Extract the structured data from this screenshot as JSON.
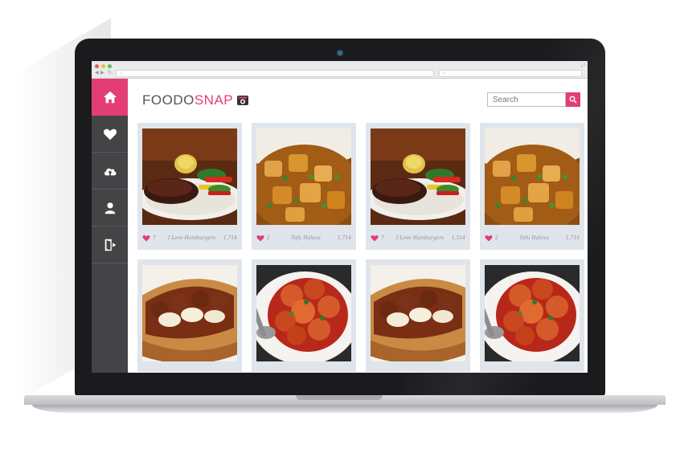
{
  "app": {
    "logo_part1": "FOODO",
    "logo_part2": "SNAP",
    "accent_color": "#e33d75"
  },
  "search": {
    "placeholder": "Search"
  },
  "sidebar": {
    "items": [
      {
        "icon": "home-icon",
        "active": true
      },
      {
        "icon": "heart-icon",
        "active": false
      },
      {
        "icon": "upload-cloud-icon",
        "active": false
      },
      {
        "icon": "user-icon",
        "active": false
      },
      {
        "icon": "logout-icon",
        "active": false
      }
    ]
  },
  "posts": [
    {
      "likes": "7",
      "title": "I Love Hamburgers",
      "views": "1,714",
      "dish": "steak"
    },
    {
      "likes": "2",
      "title": "Tofu Haluva",
      "views": "1,714",
      "dish": "stew"
    },
    {
      "likes": "7",
      "title": "I Love Hamburgers",
      "views": "1,514",
      "dish": "steak"
    },
    {
      "likes": "2",
      "title": "Tofu Haluva",
      "views": "1,714",
      "dish": "stew"
    },
    {
      "dish": "sub"
    },
    {
      "dish": "chicken"
    },
    {
      "dish": "sub"
    },
    {
      "dish": "chicken"
    }
  ]
}
